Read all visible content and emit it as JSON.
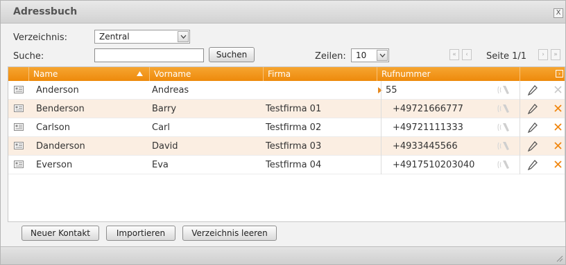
{
  "window": {
    "title": "Adressbuch",
    "close_label": "X"
  },
  "filter": {
    "directory_label": "Verzeichnis:",
    "directory_value": "Zentral",
    "search_label": "Suche:",
    "search_value": "",
    "search_button": "Suchen",
    "rows_label": "Zeilen:",
    "rows_value": "10",
    "page_label": "Seite 1/1"
  },
  "table": {
    "columns": [
      "Name",
      "Vorname",
      "Firma",
      "Rufnummer"
    ],
    "sorted_column": "Name",
    "sort_direction": "ascending",
    "rows": [
      {
        "name": "Anderson",
        "vorname": "Andreas",
        "firma": "",
        "rufnummer": "55",
        "expanded": true,
        "delete_enabled": false
      },
      {
        "name": "Benderson",
        "vorname": "Barry",
        "firma": "Testfirma 01",
        "rufnummer": "+49721666777",
        "delete_enabled": true
      },
      {
        "name": "Carlson",
        "vorname": "Carl",
        "firma": "Testfirma 02",
        "rufnummer": "+49721111333",
        "delete_enabled": true
      },
      {
        "name": "Danderson",
        "vorname": "David",
        "firma": "Testfirma 03",
        "rufnummer": "+4933445566",
        "delete_enabled": true
      },
      {
        "name": "Everson",
        "vorname": "Eva",
        "firma": "Testfirma 04",
        "rufnummer": "+4917510203040",
        "delete_enabled": true
      }
    ]
  },
  "footer": {
    "new_contact": "Neuer Kontakt",
    "import": "Importieren",
    "clear_directory": "Verzeichnis leeren"
  },
  "colors": {
    "header_orange": "#ee8a0b",
    "row_alt": "#fbeee2",
    "delete_active": "#f0860f",
    "delete_inactive": "#c8c8c8"
  },
  "icons": {
    "row_icon": "contact-card-icon",
    "call": "phone-call-icon",
    "edit": "pencil-icon",
    "delete": "delete-x-icon"
  }
}
